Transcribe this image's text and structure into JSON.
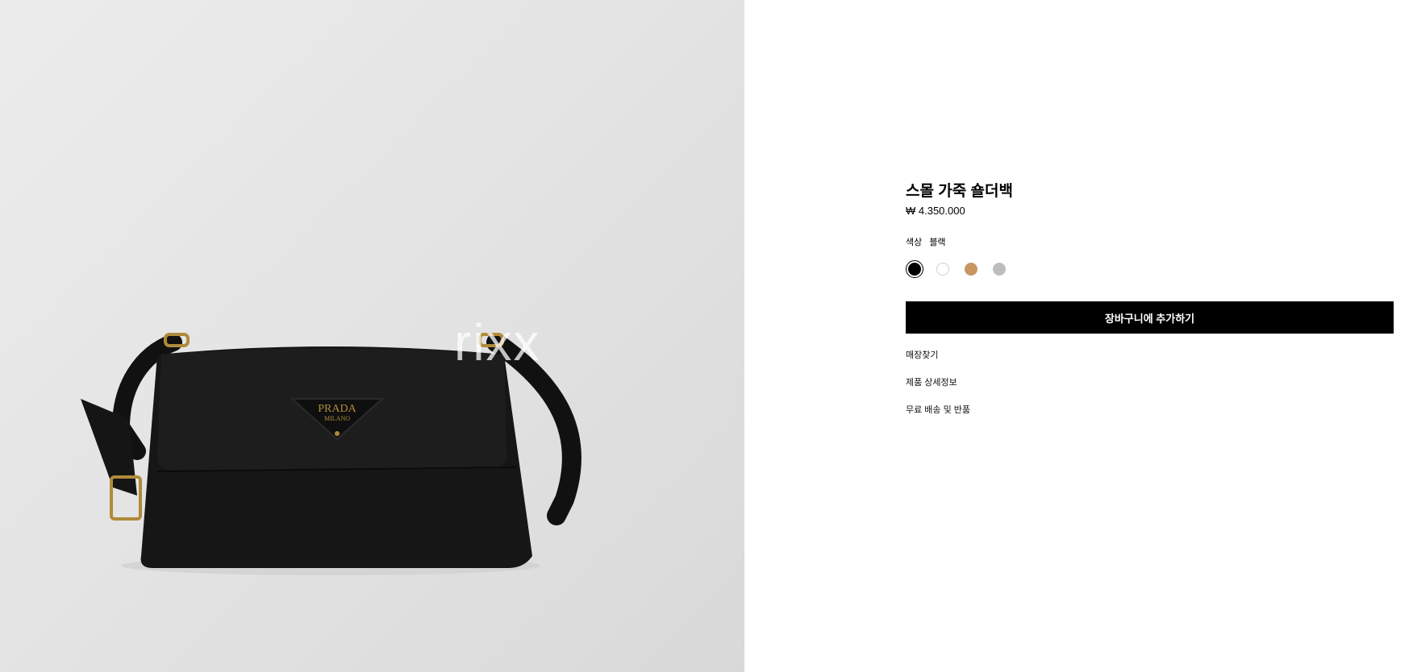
{
  "product_image": {
    "brand_plate_line1": "PRADA",
    "brand_plate_line2": "MILANO",
    "watermark": "rixx"
  },
  "product": {
    "title": "스몰 가죽 숄더백",
    "price": "₩ 4.350.000"
  },
  "color": {
    "label": "색상",
    "selected_name": "블랙",
    "swatches": [
      {
        "name": "black",
        "hex": "#000000",
        "selected": true
      },
      {
        "name": "white",
        "hex": "#ffffff",
        "selected": false
      },
      {
        "name": "tan",
        "hex": "#c8965f",
        "selected": false
      },
      {
        "name": "grey",
        "hex": "#bdbdbd",
        "selected": false
      }
    ]
  },
  "actions": {
    "add_to_cart": "장바구니에 추가하기"
  },
  "links": {
    "find_store": "매장찾기",
    "product_details": "제품 상세정보",
    "shipping_returns": "무료 배송 및 반품"
  }
}
